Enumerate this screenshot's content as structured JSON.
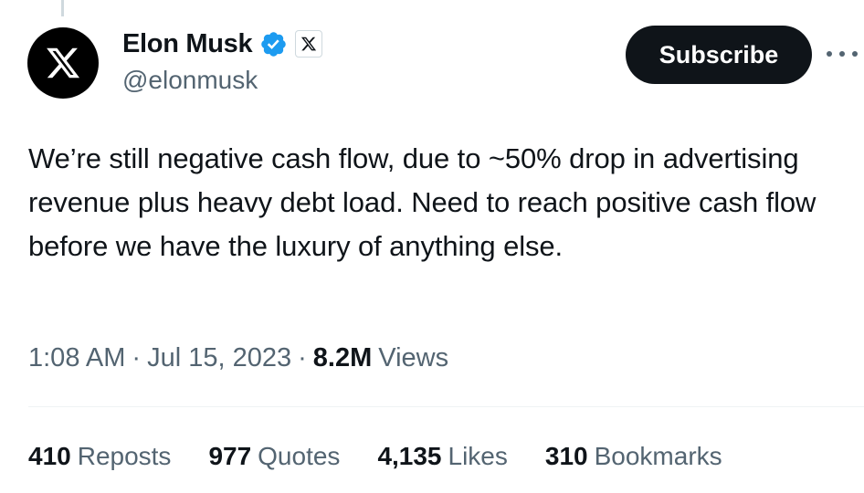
{
  "author": {
    "display_name": "Elon Musk",
    "handle": "@elonmusk",
    "verified": true,
    "affiliate_badge": "x-logo-icon"
  },
  "actions": {
    "subscribe_label": "Subscribe",
    "more_icon": "more-horizontal-icon"
  },
  "tweet": {
    "text": "We’re still negative cash flow, due to ~50% drop in advertising revenue plus heavy debt load. Need to reach positive cash flow before we have the luxury of anything else."
  },
  "meta": {
    "time": "1:08 AM",
    "separator": "·",
    "date": "Jul 15, 2023",
    "views_count": "8.2M",
    "views_label": "Views"
  },
  "stats": [
    {
      "count": "410",
      "label": "Reposts"
    },
    {
      "count": "977",
      "label": "Quotes"
    },
    {
      "count": "4,135",
      "label": "Likes"
    },
    {
      "count": "310",
      "label": "Bookmarks"
    }
  ],
  "colors": {
    "text_primary": "#0f1419",
    "text_secondary": "#536471",
    "verified_blue": "#1d9bf0",
    "button_bg": "#0f1419",
    "divider": "#eff3f4"
  }
}
